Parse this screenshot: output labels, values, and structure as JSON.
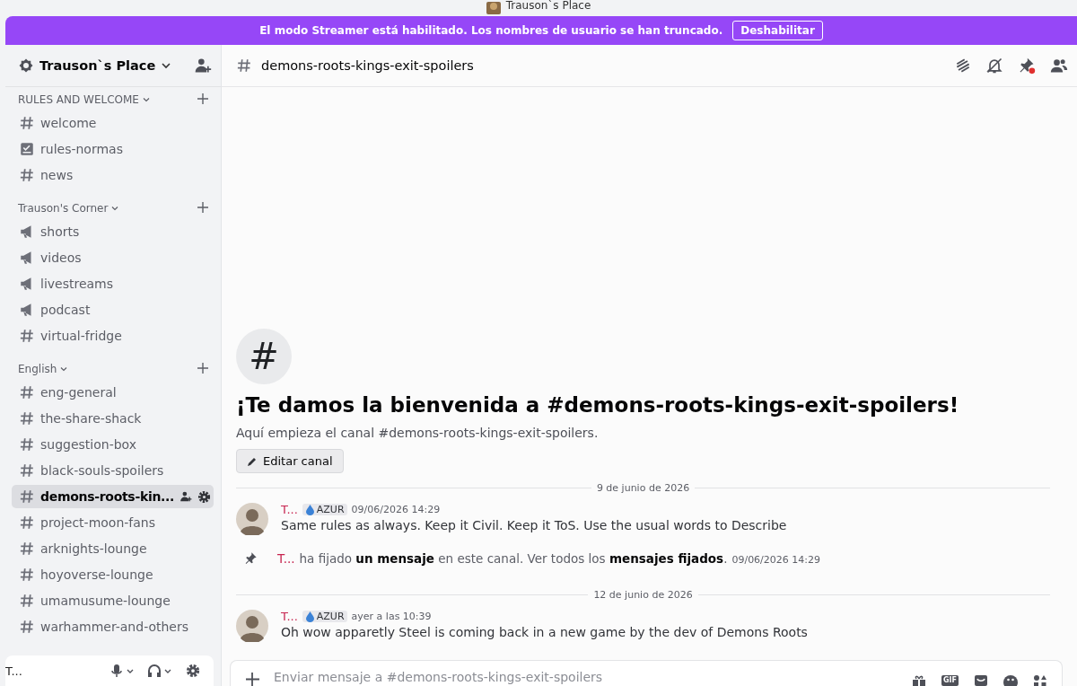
{
  "titlebar": {
    "title": "Trauson`s Place"
  },
  "banner": {
    "text": "El modo Streamer está habilitado. Los nombres de usuario se han truncado.",
    "button": "Deshabilitar"
  },
  "server": {
    "name": "Trauson`s Place"
  },
  "categories": [
    {
      "name": "RULES AND WELCOME",
      "channels": [
        {
          "name": "welcome",
          "kind": "text",
          "selected": false
        },
        {
          "name": "rules-normas",
          "kind": "rules",
          "selected": false
        },
        {
          "name": "news",
          "kind": "text",
          "selected": false
        }
      ]
    },
    {
      "name": "Trauson's Corner",
      "channels": [
        {
          "name": "shorts",
          "kind": "announcement",
          "selected": false
        },
        {
          "name": "videos",
          "kind": "announcement",
          "selected": false
        },
        {
          "name": "livestreams",
          "kind": "announcement",
          "selected": false
        },
        {
          "name": "podcast",
          "kind": "announcement",
          "selected": false
        },
        {
          "name": "virtual-fridge",
          "kind": "text",
          "selected": false
        }
      ]
    },
    {
      "name": "English",
      "channels": [
        {
          "name": "eng-general",
          "kind": "text",
          "selected": false
        },
        {
          "name": "the-share-shack",
          "kind": "text",
          "selected": false
        },
        {
          "name": "suggestion-box",
          "kind": "text",
          "selected": false
        },
        {
          "name": "black-souls-spoilers",
          "kind": "text",
          "selected": false
        },
        {
          "name": "demons-roots-kin...",
          "kind": "text",
          "selected": true
        },
        {
          "name": "project-moon-fans",
          "kind": "text",
          "selected": false
        },
        {
          "name": "arknights-lounge",
          "kind": "text",
          "selected": false
        },
        {
          "name": "hoyoverse-lounge",
          "kind": "text",
          "selected": false
        },
        {
          "name": "umamusume-lounge",
          "kind": "text",
          "selected": false
        },
        {
          "name": "warhammer-and-others",
          "kind": "text",
          "selected": false
        }
      ]
    }
  ],
  "user_panel": {
    "name": "T..."
  },
  "channel_header": {
    "name": "demons-roots-kings-exit-spoilers"
  },
  "welcome": {
    "icon": "#",
    "title": "¡Te damos la bienvenida a #demons-roots-kings-exit-spoilers!",
    "subtitle": "Aquí empieza el canal #demons-roots-kings-exit-spoilers.",
    "edit_button": "Editar canal"
  },
  "messages": [
    {
      "kind": "divider",
      "text": "9 de junio de 2026"
    },
    {
      "kind": "message",
      "author": "T...",
      "badge": "AZUR",
      "time": "09/06/2026 14:29",
      "text": "Same rules as always. Keep it Civil. Keep it ToS. Use the usual words to Describe"
    },
    {
      "kind": "system",
      "author": "T...",
      "text": "ha fijado **un mensaje** en este canal. Ver todos los **mensajes fijados**.",
      "time": "09/06/2026 14:29"
    },
    {
      "kind": "divider",
      "text": "12 de junio de 2026"
    },
    {
      "kind": "message",
      "author": "T...",
      "badge": "AZUR",
      "time": "ayer a las 10:39",
      "text": "Oh wow apparetly Steel is coming back in a new game by the dev of Demons Roots"
    }
  ],
  "composer": {
    "placeholder": "Enviar mensaje a #demons-roots-kings-exit-spoilers",
    "gif_label": "GIF"
  }
}
